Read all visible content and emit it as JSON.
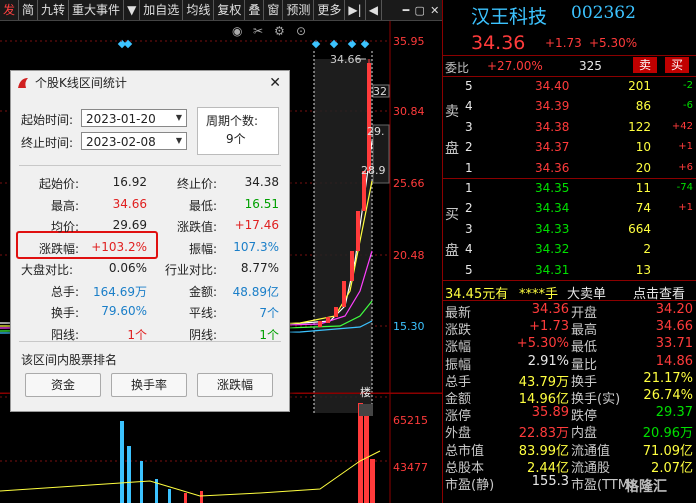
{
  "toolbar": {
    "items": [
      "发",
      "简",
      "九转",
      "重大事件",
      "▼",
      "加自选",
      "均线",
      "复权",
      "叠",
      "窗",
      "预测",
      "更多",
      "▶|",
      "◀"
    ],
    "ctrl": [
      "━",
      "▢",
      "✕"
    ]
  },
  "chart": {
    "price_labels": [
      "35.95",
      "30.84",
      "25.66",
      "20.48",
      "15.30"
    ],
    "volume_labels": [
      "65215",
      "43477"
    ],
    "high_marker": "34.66",
    "right_labels": [
      "32",
      "29.",
      "28.9"
    ],
    "bottom_tag": "楼"
  },
  "stock": {
    "name": "汉王科技",
    "code": "002362",
    "price": "34.36",
    "change": "+1.73",
    "change_pct": "+5.30%"
  },
  "commission": {
    "label": "委比",
    "ratio": "+27.00%",
    "diff": "325",
    "sell_btn": "卖",
    "buy_btn": "买"
  },
  "sell_orders": [
    {
      "level": "5",
      "price": "34.40",
      "vol": "201",
      "chg": "-2"
    },
    {
      "level": "4",
      "price": "34.39",
      "vol": "86",
      "chg": "-6"
    },
    {
      "level": "3",
      "price": "34.38",
      "vol": "122",
      "chg": "+42"
    },
    {
      "level": "2",
      "price": "34.37",
      "vol": "10",
      "chg": "+1"
    },
    {
      "level": "1",
      "price": "34.36",
      "vol": "20",
      "chg": "+6"
    }
  ],
  "sell_side_label": [
    "卖",
    "盘"
  ],
  "buy_orders": [
    {
      "level": "1",
      "price": "34.35",
      "vol": "11",
      "chg": "-74"
    },
    {
      "level": "2",
      "price": "34.34",
      "vol": "74",
      "chg": "+1"
    },
    {
      "level": "3",
      "price": "34.33",
      "vol": "664",
      "chg": ""
    },
    {
      "level": "4",
      "price": "34.32",
      "vol": "2",
      "chg": ""
    },
    {
      "level": "5",
      "price": "34.31",
      "vol": "13",
      "chg": ""
    }
  ],
  "buy_side_label": [
    "买",
    "盘"
  ],
  "trade_bar": {
    "price_text": "34.45元有",
    "stars": "****手",
    "big": "大卖单",
    "action": "点击查看"
  },
  "stats": [
    {
      "l1": "最新",
      "v1": "34.36",
      "c1": "red",
      "l2": "开盘",
      "v2": "34.20",
      "c2": "red"
    },
    {
      "l1": "涨跌",
      "v1": "+1.73",
      "c1": "red",
      "l2": "最高",
      "v2": "34.66",
      "c2": "red"
    },
    {
      "l1": "涨幅",
      "v1": "+5.30%",
      "c1": "red",
      "l2": "最低",
      "v2": "33.71",
      "c2": "red"
    },
    {
      "l1": "振幅",
      "v1": "2.91%",
      "c1": "white",
      "l2": "量比",
      "v2": "14.86",
      "c2": "red"
    },
    {
      "l1": "总手",
      "v1": "43.79万",
      "c1": "yellow",
      "l2": "换手",
      "v2": "21.17%",
      "c2": "yellow"
    },
    {
      "l1": "金额",
      "v1": "14.96亿",
      "c1": "yellow",
      "l2": "换手(实)",
      "v2": "26.74%",
      "c2": "yellow"
    },
    {
      "l1": "涨停",
      "v1": "35.89",
      "c1": "red",
      "l2": "跌停",
      "v2": "29.37",
      "c2": "green"
    },
    {
      "l1": "外盘",
      "v1": "22.83万",
      "c1": "red",
      "l2": "内盘",
      "v2": "20.96万",
      "c2": "green"
    },
    {
      "l1": "总市值",
      "v1": "83.99亿",
      "c1": "yellow",
      "l2": "流通值",
      "v2": "71.09亿",
      "c2": "yellow"
    },
    {
      "l1": "总股本",
      "v1": "2.44亿",
      "c1": "yellow",
      "l2": "流通股",
      "v2": "2.07亿",
      "c2": "yellow"
    },
    {
      "l1": "市盈(静)",
      "v1": "155.3",
      "c1": "white",
      "l2": "市盈(TTM)",
      "v2": "",
      "c2": "white"
    }
  ],
  "watermark": "格隆汇",
  "dialog": {
    "title": "个股K线区间统计",
    "close": "✕",
    "start_label": "起始时间:",
    "start_value": "2023-01-20",
    "end_label": "终止时间:",
    "end_value": "2023-02-08",
    "period_label": "周期个数:",
    "period_value": "9个",
    "rows": [
      {
        "l1": "起始价:",
        "v1": "16.92",
        "c1": "#222",
        "l2": "终止价:",
        "v2": "34.38",
        "c2": "#222"
      },
      {
        "l1": "最高:",
        "v1": "34.66",
        "c1": "#e02020",
        "l2": "最低:",
        "v2": "16.51",
        "c2": "#00a000"
      },
      {
        "l1": "均价:",
        "v1": "29.69",
        "c1": "#222",
        "l2": "涨跌值:",
        "v2": "+17.46",
        "c2": "#e02020"
      },
      {
        "l1": "涨跌幅:",
        "v1": "+103.2%",
        "c1": "#e02020",
        "l2": "振幅:",
        "v2": "107.3%",
        "c2": "#1a7ec8"
      },
      {
        "l1": "大盘对比:",
        "v1": "0.06%",
        "c1": "#222",
        "l2": "行业对比:",
        "v2": "8.77%",
        "c2": "#222"
      },
      {
        "l1": "总手:",
        "v1": "164.69万",
        "c1": "#1a7ec8",
        "l2": "金额:",
        "v2": "48.89亿",
        "c2": "#1a7ec8"
      },
      {
        "l1": "换手:",
        "v1": "79.60%",
        "c1": "#1a7ec8",
        "l2": "平线:",
        "v2": "7个",
        "c2": "#1a7ec8"
      },
      {
        "l1": "阳线:",
        "v1": "1个",
        "c1": "#e02020",
        "l2": "阴线:",
        "v2": "1个",
        "c2": "#00a000"
      }
    ],
    "rank_label": "该区间内股票排名",
    "buttons": [
      "资金",
      "换手率",
      "涨跌幅"
    ]
  }
}
